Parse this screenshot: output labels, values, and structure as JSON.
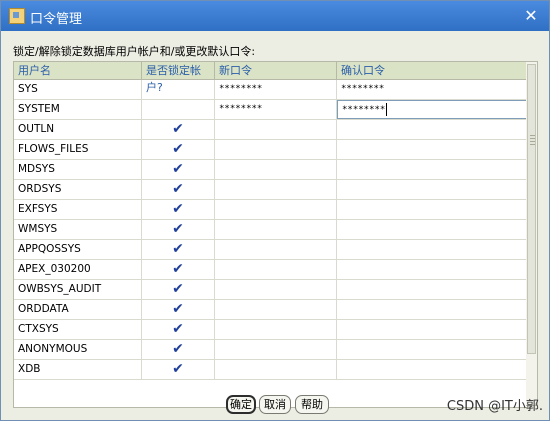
{
  "window": {
    "title": "口令管理",
    "close_glyph": "✕"
  },
  "instruction": "锁定/解除锁定数据库用户帐户和/或更改默认口令:",
  "table": {
    "columns": [
      "用户名",
      "是否锁定帐户?",
      "新口令",
      "确认口令"
    ],
    "rows": [
      {
        "user": "SYS",
        "locked": false,
        "new_pwd": "********",
        "confirm_pwd": "********"
      },
      {
        "user": "SYSTEM",
        "locked": false,
        "new_pwd": "********",
        "confirm_pwd": "********"
      },
      {
        "user": "OUTLN",
        "locked": true,
        "new_pwd": "",
        "confirm_pwd": ""
      },
      {
        "user": "FLOWS_FILES",
        "locked": true,
        "new_pwd": "",
        "confirm_pwd": ""
      },
      {
        "user": "MDSYS",
        "locked": true,
        "new_pwd": "",
        "confirm_pwd": ""
      },
      {
        "user": "ORDSYS",
        "locked": true,
        "new_pwd": "",
        "confirm_pwd": ""
      },
      {
        "user": "EXFSYS",
        "locked": true,
        "new_pwd": "",
        "confirm_pwd": ""
      },
      {
        "user": "WMSYS",
        "locked": true,
        "new_pwd": "",
        "confirm_pwd": ""
      },
      {
        "user": "APPQOSSYS",
        "locked": true,
        "new_pwd": "",
        "confirm_pwd": ""
      },
      {
        "user": "APEX_030200",
        "locked": true,
        "new_pwd": "",
        "confirm_pwd": ""
      },
      {
        "user": "OWBSYS_AUDIT",
        "locked": true,
        "new_pwd": "",
        "confirm_pwd": ""
      },
      {
        "user": "ORDDATA",
        "locked": true,
        "new_pwd": "",
        "confirm_pwd": ""
      },
      {
        "user": "CTXSYS",
        "locked": true,
        "new_pwd": "",
        "confirm_pwd": ""
      },
      {
        "user": "ANONYMOUS",
        "locked": true,
        "new_pwd": "",
        "confirm_pwd": ""
      },
      {
        "user": "XDB",
        "locked": true,
        "new_pwd": "",
        "confirm_pwd": ""
      }
    ],
    "check_glyph": "✔"
  },
  "buttons": {
    "ok": "确定",
    "cancel": "取消",
    "help": "帮助"
  },
  "watermark": "CSDN @IT小郭.",
  "icons": {
    "window": "key-window-icon",
    "close": "close-icon",
    "check": "checkmark-icon"
  }
}
